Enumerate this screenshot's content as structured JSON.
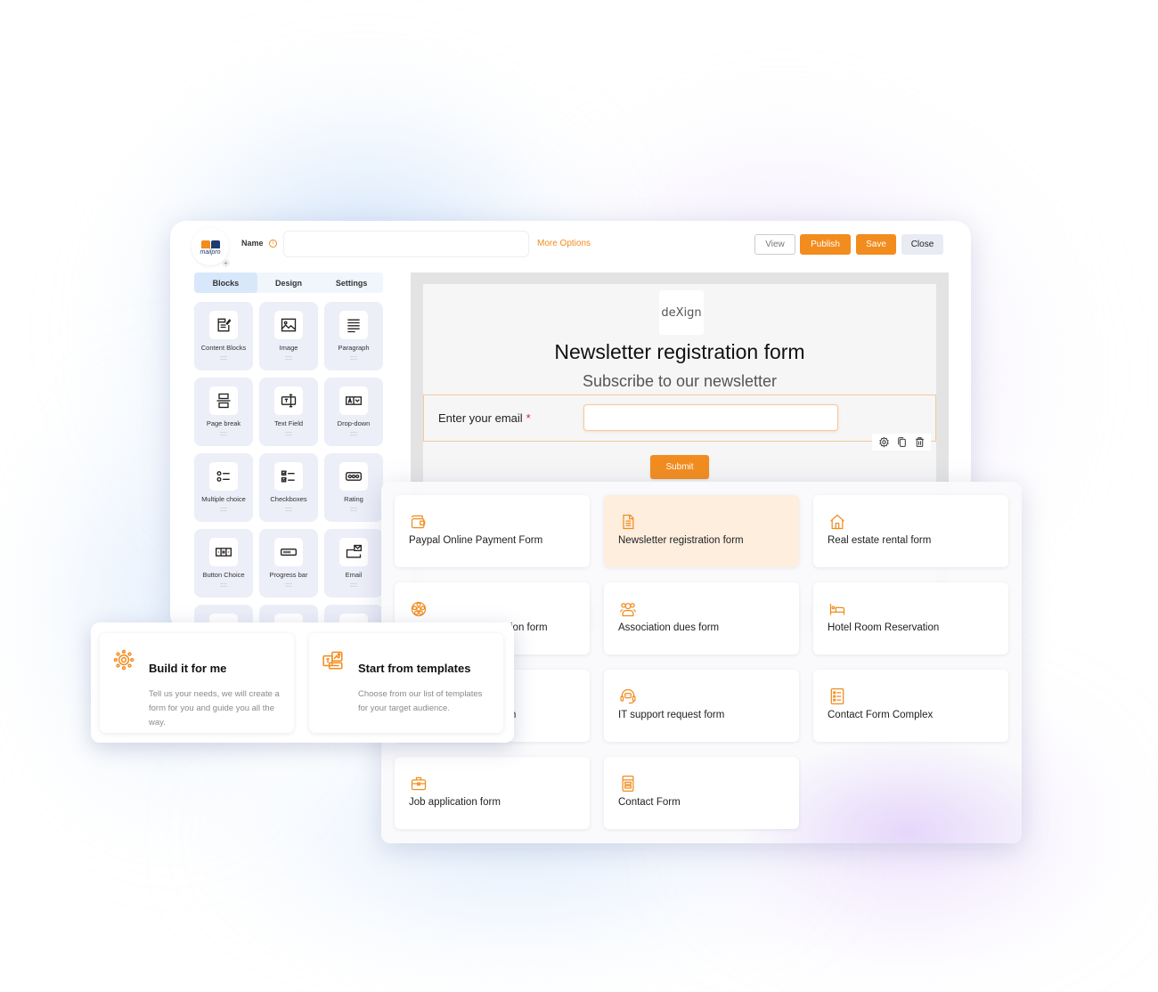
{
  "app": {
    "logo_text": "mailpro",
    "name_label": "Name",
    "name_input": {
      "value": "",
      "placeholder": ""
    },
    "more_options": "More Options",
    "buttons": {
      "view": "View",
      "publish": "Publish",
      "save": "Save",
      "close": "Close"
    },
    "brand_color": "#f28c1e"
  },
  "sidebar": {
    "tabs": [
      {
        "label": "Blocks",
        "active": true
      },
      {
        "label": "Design",
        "active": false
      },
      {
        "label": "Settings",
        "active": false
      }
    ],
    "blocks": [
      {
        "label": "Content Blocks",
        "icon": "content-blocks-icon"
      },
      {
        "label": "Image",
        "icon": "image-icon"
      },
      {
        "label": "Paragraph",
        "icon": "paragraph-icon"
      },
      {
        "label": "Page break",
        "icon": "page-break-icon"
      },
      {
        "label": "Text Field",
        "icon": "text-field-icon"
      },
      {
        "label": "Drop-down",
        "icon": "dropdown-icon"
      },
      {
        "label": "Multiple choice",
        "icon": "multiple-choice-icon"
      },
      {
        "label": "Checkboxes",
        "icon": "checkboxes-icon"
      },
      {
        "label": "Rating",
        "icon": "rating-icon"
      },
      {
        "label": "Button Choice",
        "icon": "button-choice-icon"
      },
      {
        "label": "Progress bar",
        "icon": "progress-bar-icon"
      },
      {
        "label": "Email",
        "icon": "email-icon"
      }
    ],
    "drag_handle": "::::"
  },
  "canvas": {
    "form_logo": "deXign",
    "form_title": "Newsletter registration form",
    "form_subtitle": "Subscribe to our newsletter",
    "email_label": "Enter your email",
    "required_marker": "*",
    "email_input": {
      "value": "",
      "placeholder": ""
    },
    "submit_label": "Submit"
  },
  "templates": [
    {
      "label": "Paypal Online Payment Form",
      "icon": "wallet-icon",
      "active": false
    },
    {
      "label": "Newsletter registration form",
      "icon": "document-icon",
      "active": true
    },
    {
      "label": "Real estate rental form",
      "icon": "house-icon",
      "active": false
    },
    {
      "label": "ion form",
      "icon": "soccer-ball-icon",
      "active": false
    },
    {
      "label": "Association dues form",
      "icon": "users-icon",
      "active": false
    },
    {
      "label": "Hotel Room Reservation",
      "icon": "bed-icon",
      "active": false
    },
    {
      "label": "n",
      "icon": "",
      "active": false
    },
    {
      "label": "IT support request form",
      "icon": "headset-icon",
      "active": false
    },
    {
      "label": "Contact Form Complex",
      "icon": "list-icon",
      "active": false
    },
    {
      "label": "Job application form",
      "icon": "briefcase-icon",
      "active": false
    },
    {
      "label": "Contact Form",
      "icon": "form-icon",
      "active": false
    }
  ],
  "start_options": [
    {
      "title": "Build it for me",
      "description": "Tell us your needs, we will create a form for you and guide you all the way.",
      "icon": "gear-cog-icon"
    },
    {
      "title": "Start from templates",
      "description": "Choose from our list of templates for your target audience.",
      "icon": "templates-icon"
    }
  ]
}
